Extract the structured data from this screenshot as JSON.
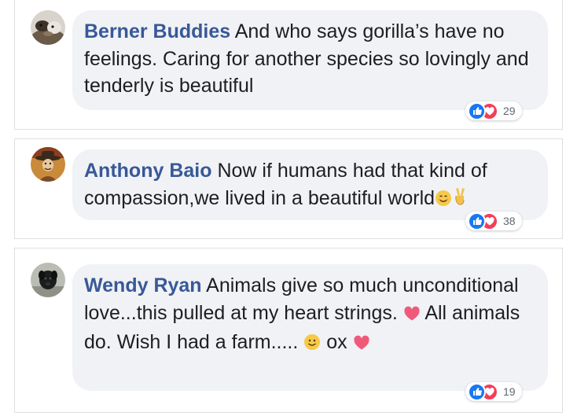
{
  "comments": [
    {
      "author": "Berner Buddies",
      "text": "And who says gorilla’s have no feelings. Caring for another species so lovingly and tenderly is beautiful",
      "reaction_count": "29",
      "avatar_icon": "dog-avatar-icon"
    },
    {
      "author": "Anthony Baio",
      "text": "Now if humans had that kind of compassion,we lived in a beautiful world",
      "reaction_count": "38",
      "avatar_icon": "cowboy-avatar-icon"
    },
    {
      "author": "Wendy Ryan",
      "text_part1": "Animals give so much unconditional love...this pulled at my heart strings.",
      "text_part2": "All animals do. Wish I had a farm.....",
      "text_part3": "ox",
      "reaction_count": "19",
      "avatar_icon": "dog-avatar-icon"
    }
  ],
  "colors": {
    "author_blue": "#385898",
    "bubble_bg": "#f0f2f5",
    "like_blue": "#1877f2",
    "love_red": "#f33e58"
  }
}
